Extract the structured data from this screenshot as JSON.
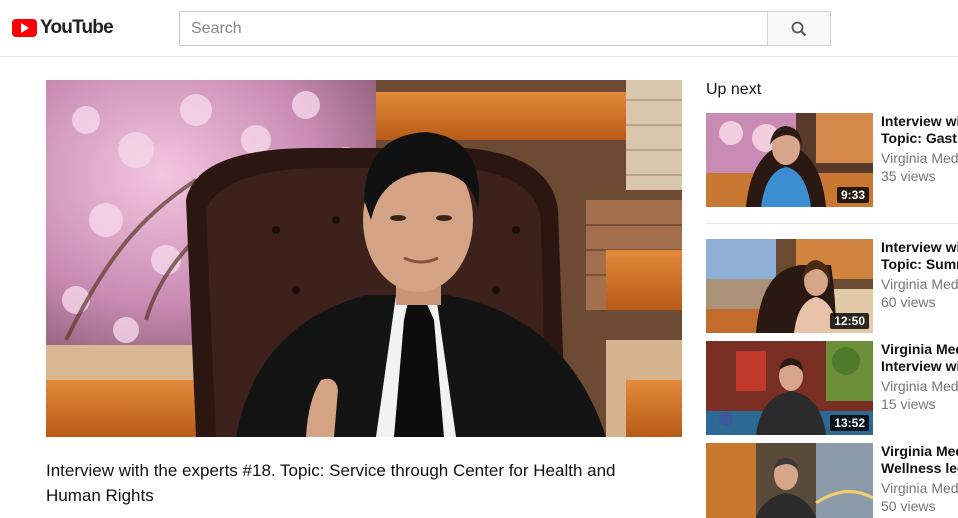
{
  "header": {
    "logo_text": "YouTube",
    "search_placeholder": "Search"
  },
  "video": {
    "title": "Interview with the experts #18. Topic: Service through Center for Health and Human Rights"
  },
  "upnext": {
    "heading": "Up next",
    "items": [
      {
        "title_line1": "Interview with the experts",
        "title_line2": "Topic: Gastroenterology",
        "channel": "Virginia Medical Updates",
        "views": "35 views",
        "duration": "9:33"
      },
      {
        "title_line1": "Interview with the experts",
        "title_line2": "Topic: Summer",
        "channel": "Virginia Medical Updates",
        "views": "60 views",
        "duration": "12:50"
      },
      {
        "title_line1": "Virginia Medical Updates",
        "title_line2": "Interview with",
        "channel": "Virginia Medical Updates",
        "views": "15 views",
        "duration": "13:52"
      },
      {
        "title_line1": "Virginia Medical Updates",
        "title_line2": "Wellness lecture",
        "channel": "Virginia Medical Updates",
        "views": "50 views",
        "duration": ""
      }
    ]
  },
  "colors": {
    "brand_red": "#ff0000",
    "meta_gray": "#767676"
  }
}
